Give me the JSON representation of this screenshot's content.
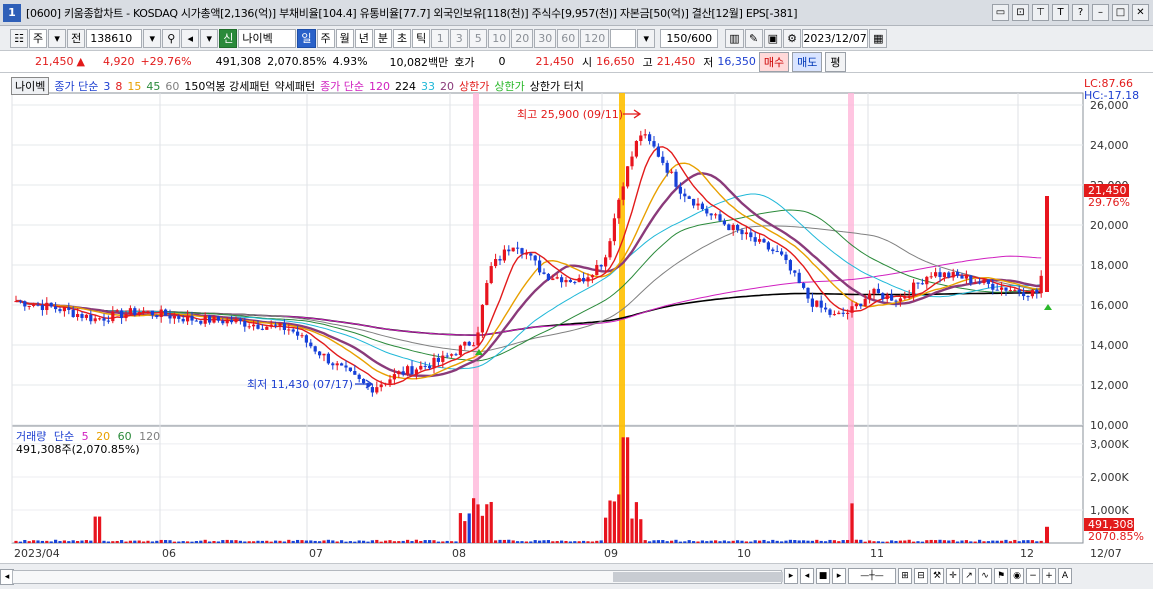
{
  "title": {
    "win_num": "1",
    "text": "[0600] 키움종합차트 - KOSDAQ 시가총액[2,136(억)] 부채비율[104.4] 유통비율[77.7] 외국인보유[118(천)] 주식수[9,957(천)] 자본금[50(억)] 결산[12월] EPS[-381]"
  },
  "toolbar": {
    "period": "주",
    "prev": "전",
    "code": "138610",
    "stock_badge": "신",
    "stock_name": "나이벡",
    "tabs": [
      "일",
      "주",
      "월",
      "년",
      "분",
      "초",
      "틱"
    ],
    "nums": [
      "1",
      "3",
      "5",
      "10",
      "20",
      "30",
      "60",
      "120"
    ],
    "count": "150/600",
    "date": "2023/12/07"
  },
  "info": {
    "price": "21,450",
    "change": "4,920",
    "pct": "+29.76%",
    "volume": "491,308",
    "vol_pct": "2,070.85%",
    "turnover": "4.93%",
    "amount": "10,082백만",
    "hoga_label": "호가",
    "hoga_val": "0",
    "cur": "21,450",
    "open_label": "시",
    "open": "16,650",
    "high_label": "고",
    "high": "21,450",
    "low_label": "저",
    "low": "16,350",
    "buy": "매수",
    "sell": "매도",
    "avg": "평"
  },
  "legend": {
    "name": "나이벡",
    "ma_label": "종가 단순",
    "ma_periods": [
      "3",
      "8",
      "15",
      "45",
      "60"
    ],
    "p150": "150억봉 강세패턴",
    "weak": "약세패턴",
    "ma2_label": "종가 단순",
    "ma2_periods": [
      "120",
      "224",
      "33",
      "20"
    ],
    "upper": "상한가",
    "upper2": "상한가",
    "touch": "상한가 터치"
  },
  "vol_legend": {
    "label": "거래량",
    "ma_label": "단순",
    "periods": [
      "5",
      "20",
      "60",
      "120"
    ],
    "value": "491,308주(2,070.85%)"
  },
  "chart_data": {
    "type": "candlestick",
    "price_axis": {
      "min": 10000,
      "max": 26000,
      "ticks": [
        "26,000",
        "24,000",
        "22,000",
        "20,000",
        "18,000",
        "16,000",
        "14,000",
        "12,000",
        "10,000"
      ]
    },
    "volume_axis": {
      "ticks": [
        "3,000K",
        "2,000K",
        "1,000K"
      ]
    },
    "x_labels": [
      "2023/04",
      "06",
      "07",
      "08",
      "09",
      "10",
      "11",
      "12",
      "12/07"
    ],
    "lc": "LC:87.66",
    "hc": "HC:-17.18",
    "last_price": "21,450",
    "last_pct": "29.76%",
    "last_volume": "491,308",
    "last_vol_pct": "2070.85%",
    "high_note": "최고 25,900 (09/11)",
    "low_note": "최저 11,430 (07/17)"
  },
  "colors": {
    "up": "#e8141e",
    "down": "#1640d8",
    "accent": "#2a62c9"
  }
}
